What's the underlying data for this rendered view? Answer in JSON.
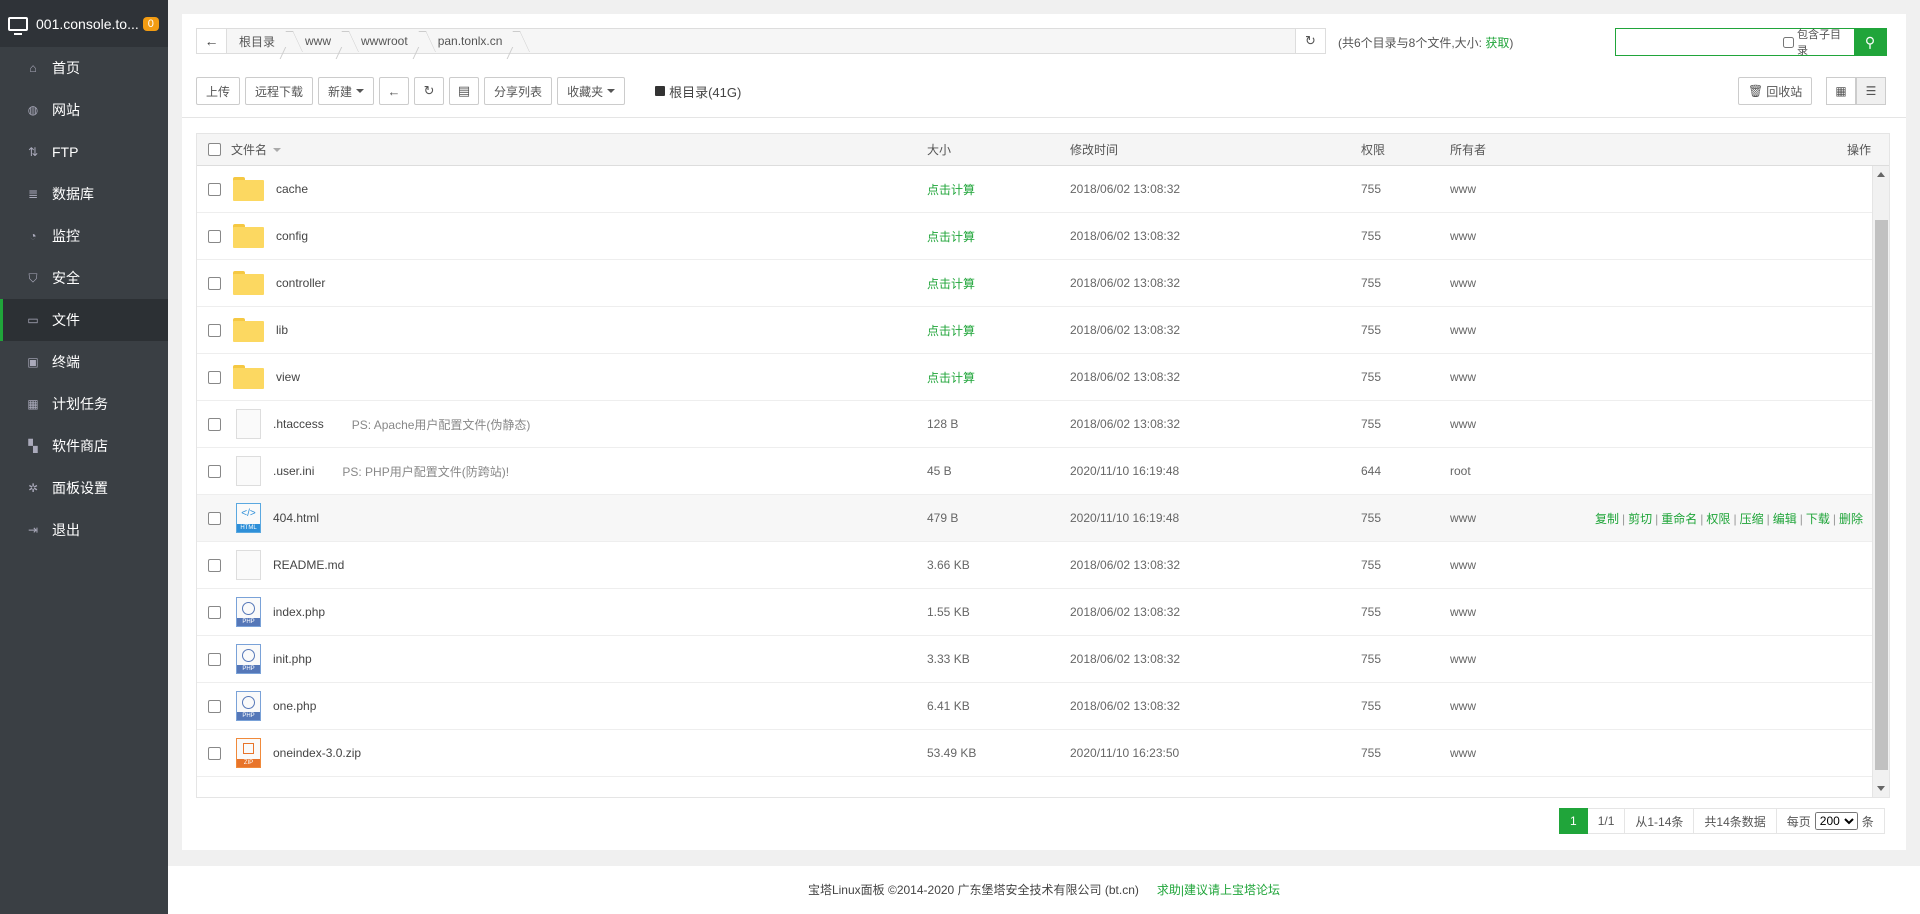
{
  "sidebar": {
    "server_title": "001.console.to...",
    "badge": "0",
    "items": [
      {
        "label": "首页",
        "icon": "home-icon",
        "active": false
      },
      {
        "label": "网站",
        "icon": "globe-icon",
        "active": false
      },
      {
        "label": "FTP",
        "icon": "ftp-icon",
        "active": false
      },
      {
        "label": "数据库",
        "icon": "database-icon",
        "active": false
      },
      {
        "label": "监控",
        "icon": "monitor-icon",
        "active": false
      },
      {
        "label": "安全",
        "icon": "shield-icon",
        "active": false
      },
      {
        "label": "文件",
        "icon": "folder-icon",
        "active": true
      },
      {
        "label": "终端",
        "icon": "terminal-icon",
        "active": false
      },
      {
        "label": "计划任务",
        "icon": "calendar-icon",
        "active": false
      },
      {
        "label": "软件商店",
        "icon": "grid-icon",
        "active": false
      },
      {
        "label": "面板设置",
        "icon": "gear-icon",
        "active": false
      },
      {
        "label": "退出",
        "icon": "logout-icon",
        "active": false
      }
    ]
  },
  "path": {
    "crumbs": [
      "根目录",
      "www",
      "wwwroot",
      "pan.tonlx.cn"
    ],
    "info": "(共6个目录与8个文件,大小: ",
    "get_label": "获取",
    "info_close": ")"
  },
  "search": {
    "placeholder": "",
    "include_sub_label": "包含子目录"
  },
  "toolbar": {
    "upload": "上传",
    "remote_download": "远程下载",
    "new": "新建",
    "share_list": "分享列表",
    "favorites": "收藏夹",
    "disk": "根目录(41G)",
    "recycle": "回收站"
  },
  "table": {
    "headers": {
      "name": "文件名",
      "size": "大小",
      "mtime": "修改时间",
      "perm": "权限",
      "owner": "所有者",
      "ops": "操作"
    },
    "rows": [
      {
        "type": "folder",
        "name": "cache",
        "ps": "",
        "size": "点击计算",
        "mtime": "2018/06/02 13:08:32",
        "perm": "755",
        "owner": "www"
      },
      {
        "type": "folder",
        "name": "config",
        "ps": "",
        "size": "点击计算",
        "mtime": "2018/06/02 13:08:32",
        "perm": "755",
        "owner": "www"
      },
      {
        "type": "folder",
        "name": "controller",
        "ps": "",
        "size": "点击计算",
        "mtime": "2018/06/02 13:08:32",
        "perm": "755",
        "owner": "www"
      },
      {
        "type": "folder",
        "name": "lib",
        "ps": "",
        "size": "点击计算",
        "mtime": "2018/06/02 13:08:32",
        "perm": "755",
        "owner": "www"
      },
      {
        "type": "folder",
        "name": "view",
        "ps": "",
        "size": "点击计算",
        "mtime": "2018/06/02 13:08:32",
        "perm": "755",
        "owner": "www"
      },
      {
        "type": "file",
        "name": ".htaccess",
        "ps": "PS: Apache用户配置文件(伪静态)",
        "size": "128 B",
        "mtime": "2018/06/02 13:08:32",
        "perm": "755",
        "owner": "www"
      },
      {
        "type": "file",
        "name": ".user.ini",
        "ps": "PS: PHP用户配置文件(防跨站)!",
        "size": "45 B",
        "mtime": "2020/11/10 16:19:48",
        "perm": "644",
        "owner": "root"
      },
      {
        "type": "html",
        "name": "404.html",
        "ps": "",
        "size": "479 B",
        "mtime": "2020/11/10 16:19:48",
        "perm": "755",
        "owner": "www"
      },
      {
        "type": "file",
        "name": "README.md",
        "ps": "",
        "size": "3.66 KB",
        "mtime": "2018/06/02 13:08:32",
        "perm": "755",
        "owner": "www"
      },
      {
        "type": "php",
        "name": "index.php",
        "ps": "",
        "size": "1.55 KB",
        "mtime": "2018/06/02 13:08:32",
        "perm": "755",
        "owner": "www"
      },
      {
        "type": "php",
        "name": "init.php",
        "ps": "",
        "size": "3.33 KB",
        "mtime": "2018/06/02 13:08:32",
        "perm": "755",
        "owner": "www"
      },
      {
        "type": "php",
        "name": "one.php",
        "ps": "",
        "size": "6.41 KB",
        "mtime": "2018/06/02 13:08:32",
        "perm": "755",
        "owner": "www"
      },
      {
        "type": "zip",
        "name": "oneindex-3.0.zip",
        "ps": "",
        "size": "53.49 KB",
        "mtime": "2020/11/10 16:23:50",
        "perm": "755",
        "owner": "www"
      }
    ],
    "hover_row_ops": [
      "复制",
      "剪切",
      "重命名",
      "权限",
      "压缩",
      "编辑",
      "下载",
      "删除"
    ],
    "icon_labels": {
      "html": "HTML",
      "php": "PHP",
      "zip": "ZIP"
    }
  },
  "pager": {
    "current": "1",
    "pages": "1/1",
    "range": "从1-14条",
    "total": "共14条数据",
    "per_page_label": "每页",
    "per_page": "200",
    "unit": "条"
  },
  "footer": {
    "copyright": "宝塔Linux面板 ©2014-2020 广东堡塔安全技术有限公司 (bt.cn)",
    "forum_link": "求助|建议请上宝塔论坛"
  },
  "colors": {
    "accent": "#20a53a",
    "sidebar_bg": "#3a3f44",
    "badge": "#f39c12"
  }
}
